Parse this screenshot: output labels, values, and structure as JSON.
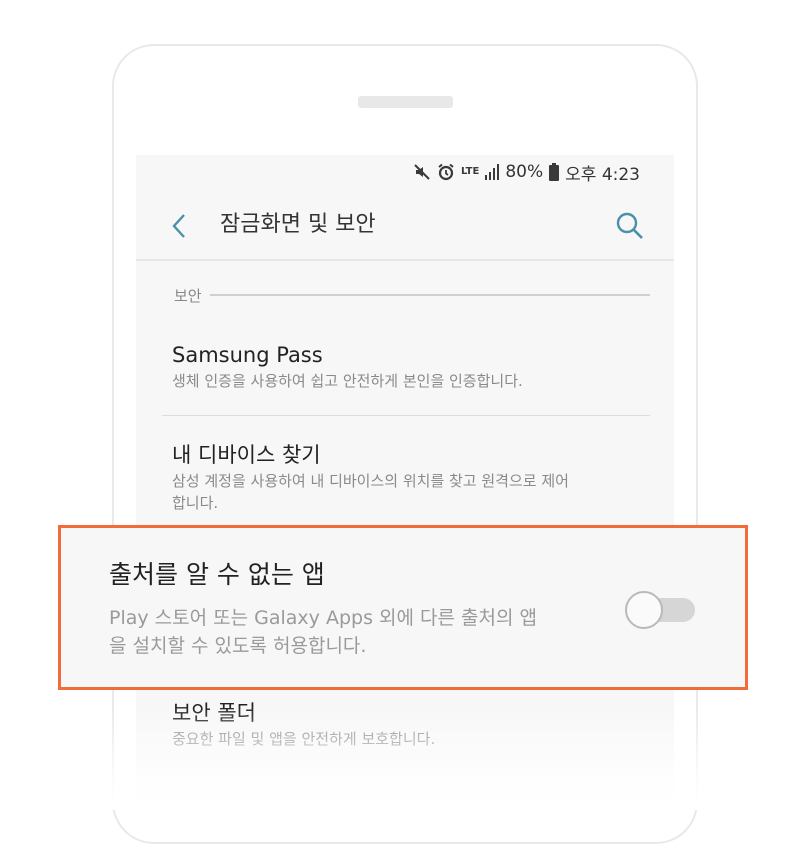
{
  "status_bar": {
    "battery": "80%",
    "time": "오후 4:23",
    "network": "LTE"
  },
  "header": {
    "title": "잠금화면 및 보안",
    "back_icon": "chevron-left-icon",
    "search_icon": "search-icon"
  },
  "section": {
    "label": "보안"
  },
  "items": [
    {
      "title": "Samsung Pass",
      "subtitle": "생체 인증을 사용하여 쉽고 안전하게 본인을 인증합니다."
    },
    {
      "title": "내 디바이스 찾기",
      "subtitle": "삼성 계정을 사용하여 내 디바이스의 위치를 찾고 원격으로 제어합니다."
    },
    {
      "title": "보안 폴더",
      "subtitle": "중요한 파일 및 앱을 안전하게 보호합니다."
    }
  ],
  "highlight": {
    "title": "출처를 알 수 없는 앱",
    "subtitle": "Play 스토어 또는 Galaxy Apps 외에 다른 출처의 앱을 설치할 수 있도록 허용합니다.",
    "toggle_on": false,
    "border_color": "#f26b3a"
  },
  "colors": {
    "accent": "#4a90a8",
    "highlight_border": "#f26b3a"
  }
}
